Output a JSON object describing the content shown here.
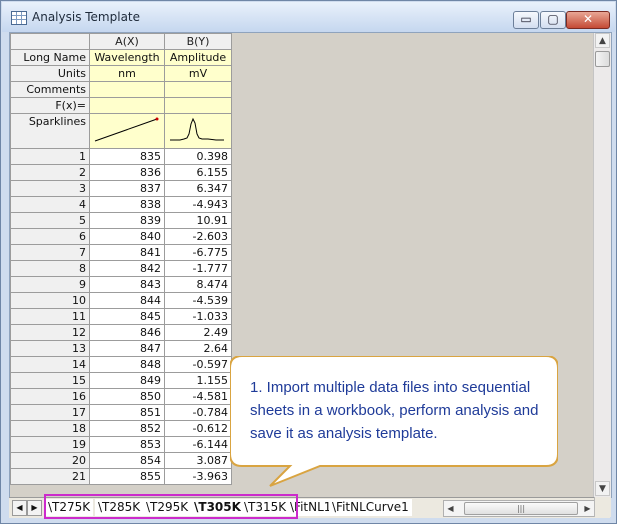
{
  "window": {
    "title": "Analysis Template",
    "buttons": {
      "minimize": "▭",
      "maximize": "▢",
      "close": "✕"
    }
  },
  "columns": [
    {
      "header": "A(X)",
      "long_name": "Wavelength",
      "units": "nm",
      "comments": "",
      "fx": ""
    },
    {
      "header": "B(Y)",
      "long_name": "Amplitude",
      "units": "mV",
      "comments": "",
      "fx": ""
    }
  ],
  "row_labels": {
    "long_name": "Long Name",
    "units": "Units",
    "comments": "Comments",
    "fx": "F(x)=",
    "sparklines": "Sparklines"
  },
  "rows": [
    {
      "n": "1",
      "a": "835",
      "b": "0.398"
    },
    {
      "n": "2",
      "a": "836",
      "b": "6.155"
    },
    {
      "n": "3",
      "a": "837",
      "b": "6.347"
    },
    {
      "n": "4",
      "a": "838",
      "b": "-4.943"
    },
    {
      "n": "5",
      "a": "839",
      "b": "10.91"
    },
    {
      "n": "6",
      "a": "840",
      "b": "-2.603"
    },
    {
      "n": "7",
      "a": "841",
      "b": "-6.775"
    },
    {
      "n": "8",
      "a": "842",
      "b": "-1.777"
    },
    {
      "n": "9",
      "a": "843",
      "b": "8.474"
    },
    {
      "n": "10",
      "a": "844",
      "b": "-4.539"
    },
    {
      "n": "11",
      "a": "845",
      "b": "-1.033"
    },
    {
      "n": "12",
      "a": "846",
      "b": "2.49"
    },
    {
      "n": "13",
      "a": "847",
      "b": "2.64"
    },
    {
      "n": "14",
      "a": "848",
      "b": "-0.597"
    },
    {
      "n": "15",
      "a": "849",
      "b": "1.155"
    },
    {
      "n": "16",
      "a": "850",
      "b": "-4.581"
    },
    {
      "n": "17",
      "a": "851",
      "b": "-0.784"
    },
    {
      "n": "18",
      "a": "852",
      "b": "-0.612"
    },
    {
      "n": "19",
      "a": "853",
      "b": "-6.144"
    },
    {
      "n": "20",
      "a": "854",
      "b": "3.087"
    },
    {
      "n": "21",
      "a": "855",
      "b": "-3.963"
    }
  ],
  "sheet_tabs": [
    {
      "label": "T275K",
      "active": false
    },
    {
      "label": "T285K",
      "active": false
    },
    {
      "label": "T295K",
      "active": false
    },
    {
      "label": "T305K",
      "active": true
    },
    {
      "label": "T315K",
      "active": false
    },
    {
      "label": "FitNL1",
      "active": false
    },
    {
      "label": "FitNLCurve1",
      "active": false
    }
  ],
  "callout": {
    "text": "1. Import multiple data files into sequential sheets in a workbook, perform analysis and save it as analysis template."
  },
  "colors": {
    "callout_border": "#d9a441",
    "callout_text": "#1f3b99",
    "tab_highlight": "#cc2bcc",
    "metadata_fill": "#ffffcc",
    "sparkline": "#000000",
    "sparkline_endpoint": "#cc0000"
  }
}
